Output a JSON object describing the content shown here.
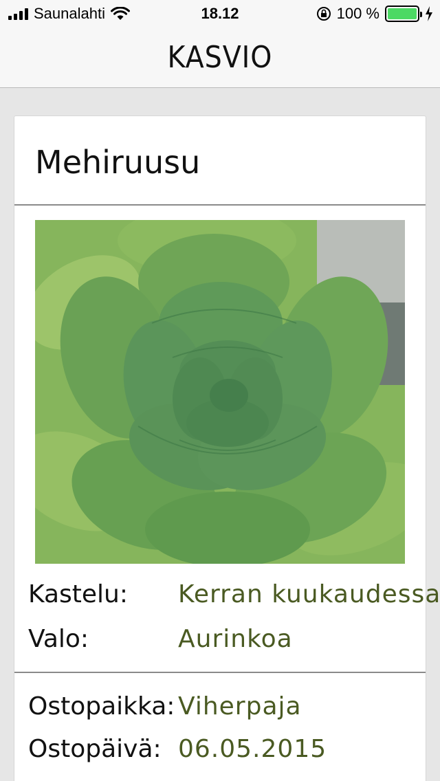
{
  "status_bar": {
    "carrier": "Saunalahti",
    "time": "18.12",
    "battery_percent": "100 %",
    "battery_level": 1.0,
    "icons": [
      "signal-icon",
      "wifi-icon",
      "rotation-lock-icon",
      "battery-icon",
      "charging-bolt-icon"
    ]
  },
  "nav": {
    "title": "KASVIO"
  },
  "plant": {
    "name": "Mehiruusu",
    "photo": "succulent-rosette-photo",
    "care": [
      {
        "label": "Kastelu:",
        "value": "Kerran  kuukaudessa"
      },
      {
        "label": "Valo:",
        "value": "Aurinkoa"
      }
    ],
    "purchase": [
      {
        "label": "Ostopaikka:",
        "value": "Viherpaja"
      },
      {
        "label": "Ostopäivä:",
        "value": "06.05.2015"
      }
    ]
  },
  "colors": {
    "value_text": "#4a5a22",
    "battery_green": "#4cd964",
    "background": "#e6e6e6"
  }
}
